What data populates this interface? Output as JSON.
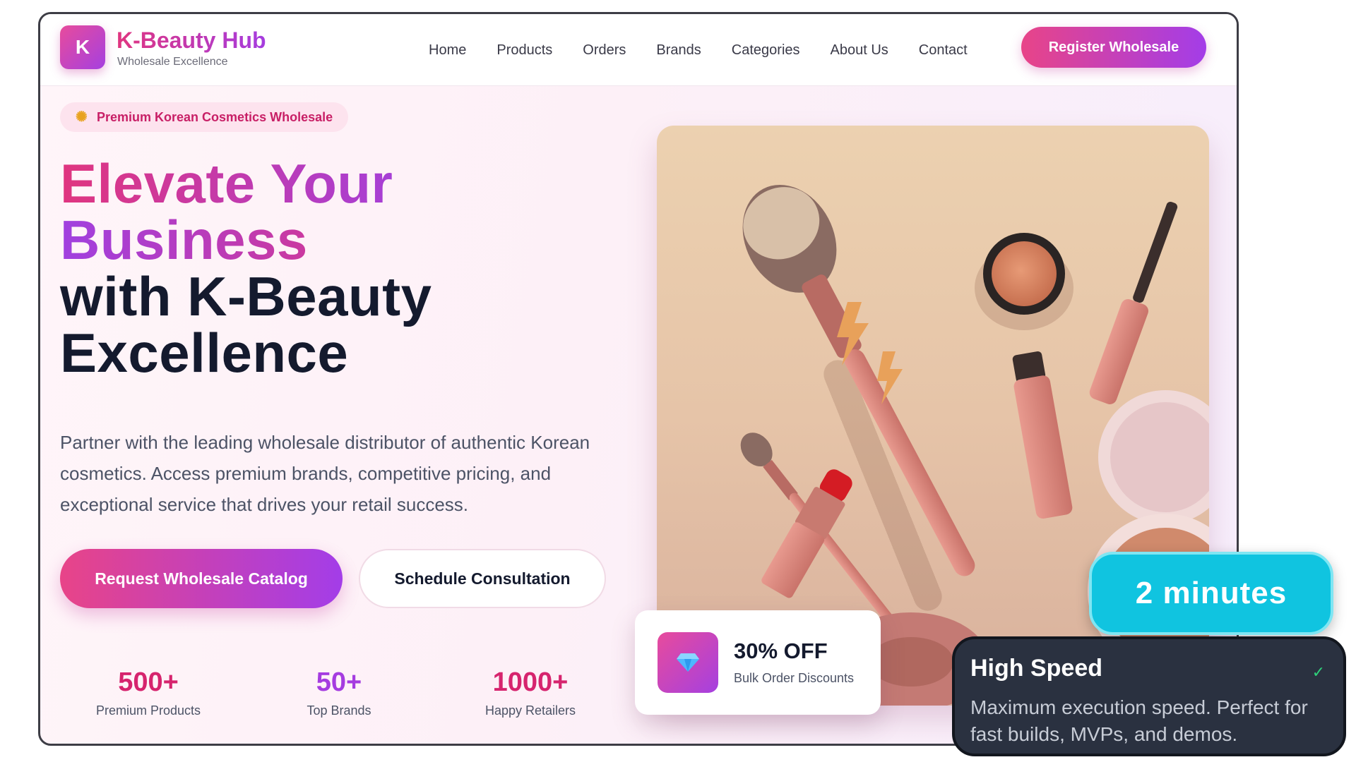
{
  "nav": {
    "logo_letter": "K",
    "brand_name": "K-Beauty Hub",
    "brand_tagline": "Wholesale Excellence",
    "links": [
      "Home",
      "Products",
      "Orders",
      "Brands",
      "Categories",
      "About Us",
      "Contact"
    ],
    "register_label": "Register Wholesale"
  },
  "hero": {
    "badge": "Premium Korean Cosmetics Wholesale",
    "title_line1": "Elevate Your",
    "title_line2": "Business",
    "title_line3": "with K-Beauty",
    "title_line4": "Excellence",
    "lead": "Partner with the leading wholesale distributor of authentic Korean cosmetics. Access premium brands, competitive pricing, and exceptional service that drives your retail success.",
    "primary_cta": "Request Wholesale Catalog",
    "secondary_cta": "Schedule Consultation"
  },
  "stats": [
    {
      "value": "500+",
      "label": "Premium Products",
      "color": "#d6246e"
    },
    {
      "value": "50+",
      "label": "Top Brands",
      "color": "#a53ce0"
    },
    {
      "value": "1000+",
      "label": "Happy Retailers",
      "color": "#d6246e"
    }
  ],
  "promo": {
    "title": "30% OFF",
    "subtitle": "Bulk Order Discounts",
    "icon": "diamond-icon"
  },
  "overlay": {
    "timer": "2 minutes",
    "card_title": "High Speed",
    "card_check": "✓",
    "card_desc": "Maximum execution speed. Perfect for fast builds, MVPs, and demos."
  },
  "colors": {
    "accent_pink": "#e84488",
    "accent_purple": "#a33de8",
    "timer_cyan": "#10c4e0",
    "card_dark": "#2a3140"
  }
}
